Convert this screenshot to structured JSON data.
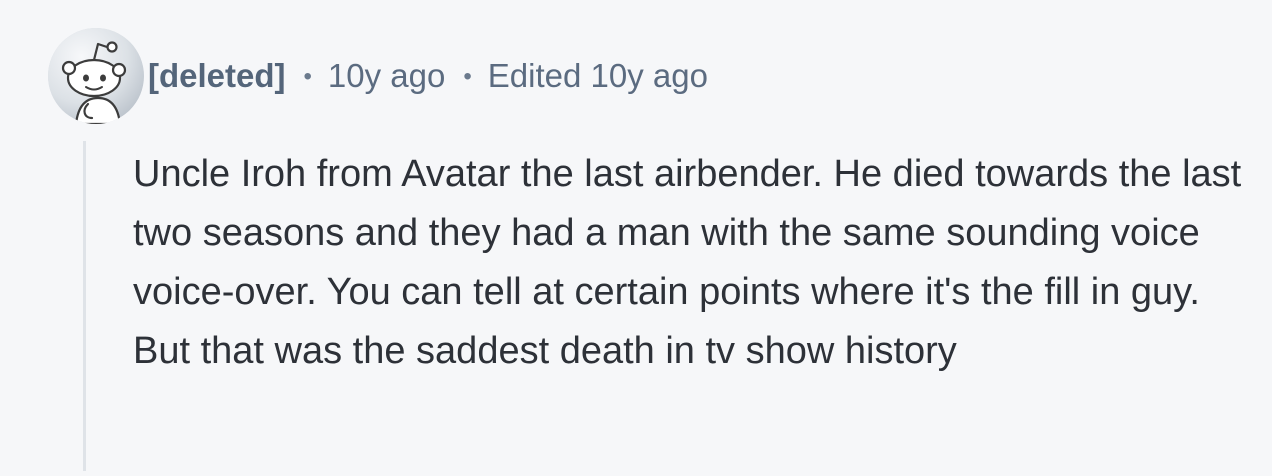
{
  "comment": {
    "author": "[deleted]",
    "separator": "•",
    "timestamp": "10y ago",
    "edited": "Edited 10y ago",
    "body": "Uncle Iroh from Avatar the last airbender. He died towards the last two seasons and they had a man with the same sounding voice voice-over. You can tell at certain points where it's the fill in guy. But that was the saddest death in tv show history",
    "avatar_icon": "snoo-avatar-icon"
  },
  "colors": {
    "background": "#f6f7f9",
    "username": "#54657a",
    "meta": "#5b6b80",
    "body_text": "#2d3138",
    "thread_line": "#dfe3e8"
  }
}
